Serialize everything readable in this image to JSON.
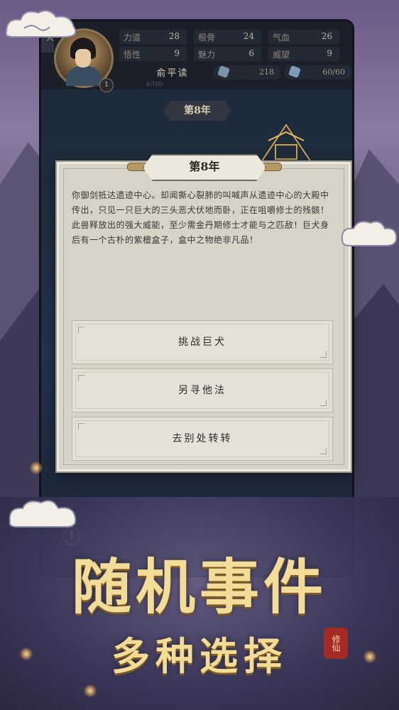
{
  "player": {
    "name": "俞平读",
    "level": "1",
    "exp": "6/100",
    "corner_tag": "灵人"
  },
  "stats": [
    {
      "label": "力道",
      "value": "28"
    },
    {
      "label": "根骨",
      "value": "24"
    },
    {
      "label": "气血",
      "value": "26"
    },
    {
      "label": "悟性",
      "value": "9"
    },
    {
      "label": "魅力",
      "value": "6"
    },
    {
      "label": "威望",
      "value": "9"
    }
  ],
  "resources": {
    "spirit_stone": "218",
    "stamina": "60/60"
  },
  "year_banner": "第8年",
  "event": {
    "title": "第8年",
    "story": "你御剑抵达遗迹中心。却闻撕心裂肺的叫喊声从遗迹中心的大殿中传出，只见一只巨大的三头恶犬伏地而卧，正在咀嚼修士的残骸！此兽释放出的强大威能，至少需金丹期修士才能与之匹敌！巨犬身后有一个古朴的紫檀盒子，盒中之物绝非凡品！",
    "choices": [
      "挑战巨犬",
      "另寻他法",
      "去别处转转"
    ]
  },
  "promo": {
    "headline": "随机事件",
    "subheadline": "多种选择",
    "seal": "修仙"
  },
  "colors": {
    "gold_text": "#f3dc97",
    "card_bg": "#d7d3c6",
    "seal_red": "#a52a25"
  }
}
